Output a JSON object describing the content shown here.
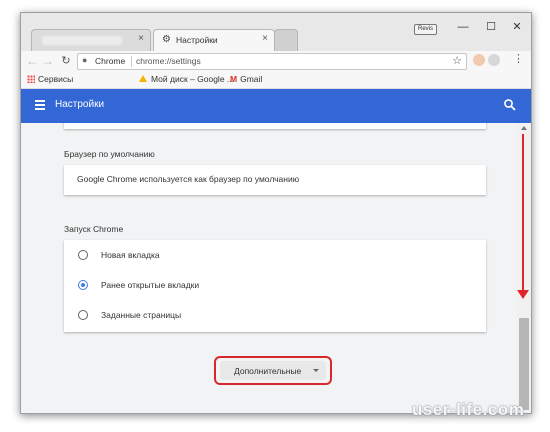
{
  "window": {
    "profile_chip": "Revis",
    "controls": {
      "minimize": "—",
      "maximize": "☐",
      "close": "✕"
    }
  },
  "tabs": [
    {
      "title": "",
      "blurred": true
    },
    {
      "title": "Настройки",
      "active": true,
      "icon": "gear-icon"
    }
  ],
  "toolbar": {
    "back": "←",
    "forward": "→",
    "reload": "↻",
    "site_chip": "Chrome",
    "url": "chrome://settings",
    "star": "☆",
    "menu": "⋮"
  },
  "bookmarks": [
    {
      "label": "Сервисы",
      "icon": "apps-grid-icon"
    },
    {
      "label": "Мой диск – Google ...",
      "icon": "google-drive-icon"
    },
    {
      "label": "Gmail",
      "icon": "gmail-icon"
    }
  ],
  "appbar": {
    "title": "Настройки",
    "color": "#3367d6"
  },
  "settings": {
    "default_browser": {
      "title": "Браузер по умолчанию",
      "text": "Google Chrome используется как браузер по умолчанию"
    },
    "on_startup": {
      "title": "Запуск Chrome",
      "options": [
        {
          "label": "Новая вкладка",
          "selected": false
        },
        {
          "label": "Ранее открытые вкладки",
          "selected": true
        },
        {
          "label": "Заданные страницы",
          "selected": false
        }
      ]
    },
    "advanced_button": "Дополнительные"
  },
  "annotations": {
    "highlight_color": "#d8282b",
    "arrow_color": "#e0242a"
  },
  "watermark": "user-life.com"
}
